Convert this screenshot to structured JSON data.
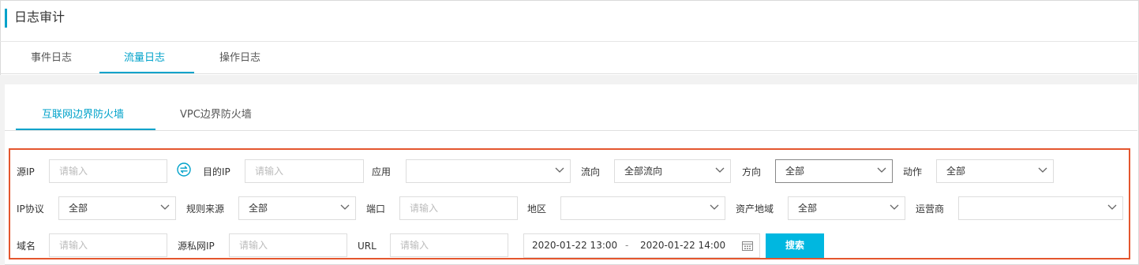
{
  "header": {
    "title": "日志审计",
    "accent_color": "#00a2ca"
  },
  "tabs": [
    {
      "label": "事件日志",
      "active": false
    },
    {
      "label": "流量日志",
      "active": true
    },
    {
      "label": "操作日志",
      "active": false
    }
  ],
  "subtabs": [
    {
      "label": "互联网边界防火墙",
      "active": true
    },
    {
      "label": "VPC边界防火墙",
      "active": false
    }
  ],
  "filters": {
    "source_ip": {
      "label": "源IP",
      "placeholder": "请输入"
    },
    "swap_icon": "swap-icon",
    "dest_ip": {
      "label": "目的IP",
      "placeholder": "请输入"
    },
    "application": {
      "label": "应用",
      "value": ""
    },
    "flow_direction": {
      "label": "流向",
      "value": "全部流向"
    },
    "direction": {
      "label": "方向",
      "value": "全部"
    },
    "action": {
      "label": "动作",
      "value": "全部"
    },
    "ip_protocol": {
      "label": "IP协议",
      "value": "全部"
    },
    "rule_source": {
      "label": "规则来源",
      "value": "全部"
    },
    "port": {
      "label": "端口",
      "placeholder": "请输入"
    },
    "region": {
      "label": "地区",
      "value": ""
    },
    "asset_region": {
      "label": "资产地域",
      "value": "全部"
    },
    "isp": {
      "label": "运营商",
      "value": ""
    },
    "domain": {
      "label": "域名",
      "placeholder": "请输入"
    },
    "source_private_ip": {
      "label": "源私网IP",
      "placeholder": "请输入"
    },
    "url": {
      "label": "URL",
      "placeholder": "请输入"
    },
    "time_range": {
      "start": "2020-01-22 13:00",
      "separator": "-",
      "end": "2020-01-22 14:00",
      "icon": "calendar-icon"
    },
    "search_button": "搜索"
  },
  "colors": {
    "highlight_border": "#e4562e",
    "button": "#00b7e0"
  }
}
